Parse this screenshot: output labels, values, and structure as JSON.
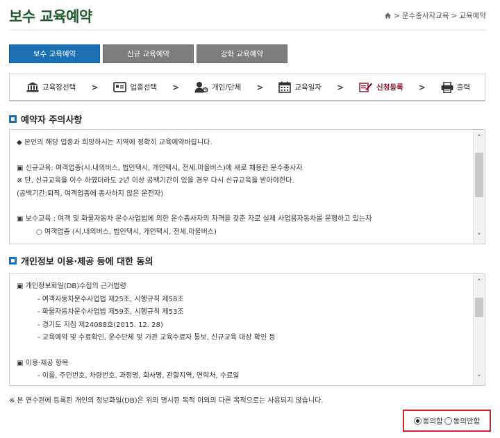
{
  "page": {
    "title": "보수 교육예약",
    "breadcrumb": [
      "운수종사자교육",
      "교육예약"
    ],
    "breadcrumb_sep": ">"
  },
  "tabs": [
    {
      "label": "보수 교육예약",
      "active": true
    },
    {
      "label": "신규 교육예약",
      "active": false
    },
    {
      "label": "강화 교육예약",
      "active": false
    }
  ],
  "steps": [
    {
      "label": "교육장선택",
      "icon": "bank-icon",
      "current": false
    },
    {
      "label": "업종선택",
      "icon": "card-icon",
      "current": false
    },
    {
      "label": "개인/단체",
      "icon": "person-gear-icon",
      "current": false
    },
    {
      "label": "교육일자",
      "icon": "calendar-icon",
      "current": false
    },
    {
      "label": "신청등록",
      "icon": "pencil-icon",
      "current": true
    },
    {
      "label": "출력",
      "icon": "printer-icon",
      "current": false
    }
  ],
  "step_arrow": ">",
  "notice_section": {
    "title": "예약자 주의사항",
    "lines": [
      "◆ 본인의 해당 업종과 희망하시는 지역에 정확히 교육예약바랍니다.",
      "",
      "▣ 신규교육: 여객업종(시.내외버스, 법인택시, 개인택시, 전세.마을버스)에 새로 채용한 운수종사자",
      "※ 단, 신규교육을 이수 하였더라도 2년 이상 공백기간이 있을 경우 다시 신규교육을 받아야한다.",
      "(공백기간:퇴직, 여객업종에 종사하지 않은 운전자)",
      "",
      "▣ 보수교육 : 여객 및 화물자동차 운수사업법에 의한 운수종사자의 자격을 갖춘 자로 실제 사업용자동차를 운행하고 있는자",
      "○ 여객업종 (시.내외버스, 법인택시, 개인택시, 전세.마을버스)"
    ]
  },
  "privacy_section": {
    "title": "개인정보 이용·제공 등에 대한 동의",
    "lines": [
      "▣ 개인정보화일(DB)수집의 근거법령",
      "- 여객자동차운수사업법 제25조, 시행규칙 제58조",
      "- 화물자동차운수사업법 제59조, 시행규칙 제53조",
      "- 경기도 지침 제24088호(2015. 12. 28)",
      "- 교육예약 및 수료확인, 운수단체 및 기관 교육수료자 통보, 신규교육 대상 확인 등",
      "",
      "▣ 이용·제공 항목",
      "- 이름, 주민번호, 차량번호, 과정명, 회사명, 관할지역, 연락처, 수료일"
    ]
  },
  "footer_notice": "※ 본 연수원에 등록된 개인의 정보화일(DB)은 위의 명시된 목적 이외의 다른 목적으로는 사용되지 않습니다.",
  "consent": {
    "agree_label": "동의함",
    "disagree_label": "동의안함",
    "selected": "agree"
  },
  "colors": {
    "title_green": "#1f5a2a",
    "tab_active": "#1b6fb5",
    "tab_inactive": "#7d7d7d",
    "step_current": "#8b1a2e",
    "highlight_red": "#d2232a"
  }
}
